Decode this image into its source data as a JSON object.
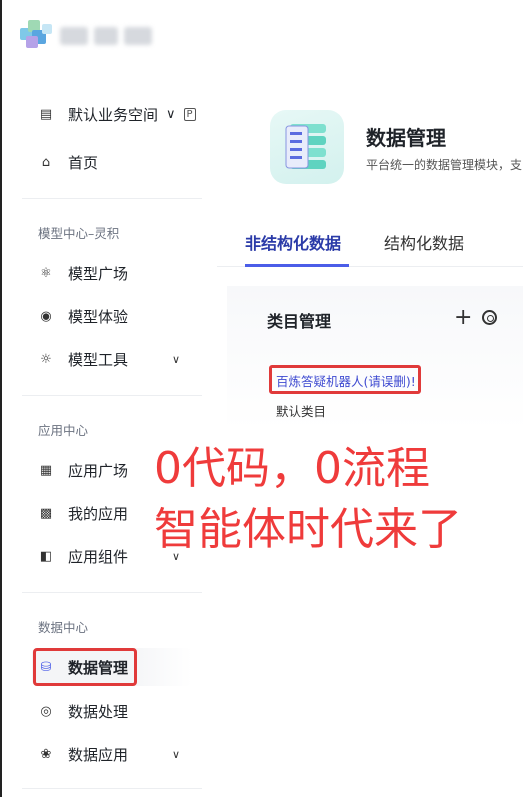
{
  "workspace": {
    "label": "默认业务空间",
    "chevron": "∨"
  },
  "nav": {
    "home": "首页",
    "sections": [
      {
        "label": "模型中心–灵积",
        "items": [
          "模型广场",
          "模型体验",
          "模型工具"
        ]
      },
      {
        "label": "应用中心",
        "items": [
          "应用广场",
          "我的应用",
          "应用组件"
        ]
      },
      {
        "label": "数据中心",
        "items": [
          "数据管理",
          "数据处理",
          "数据应用"
        ]
      }
    ],
    "active": "数据管理"
  },
  "header": {
    "title": "数据管理",
    "subtitle": "平台统一的数据管理模块，支"
  },
  "tabs": [
    {
      "label": "非结构化数据",
      "active": true
    },
    {
      "label": "结构化数据",
      "active": false
    }
  ],
  "category": {
    "title": "类目管理",
    "add": "+",
    "items": [
      "百炼答疑机器人(请误删)!",
      "默认类目"
    ]
  },
  "overlay": {
    "line1": "0代码，0流程",
    "line2": "智能体时代来了"
  },
  "colors": {
    "accent": "#4b5de8",
    "highlight": "#e03a3a",
    "overlay_text": "#ef3b3b"
  }
}
